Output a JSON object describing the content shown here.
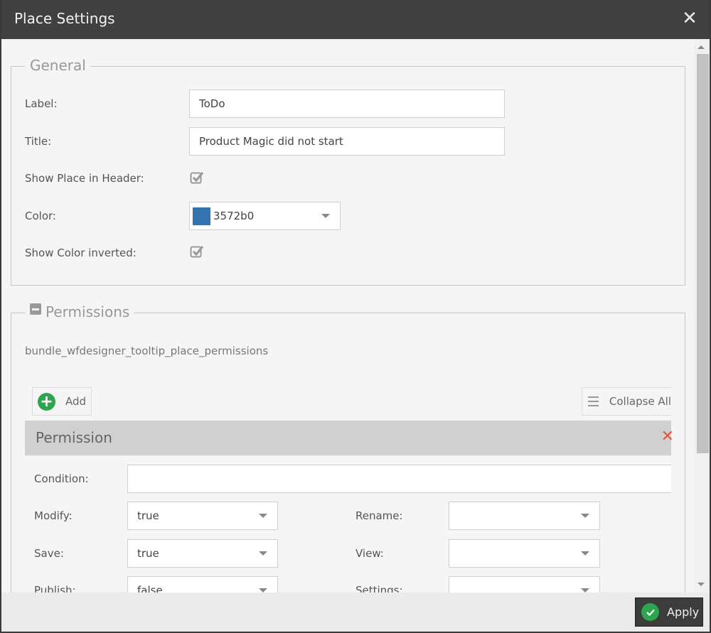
{
  "dialog": {
    "title": "Place Settings",
    "close_icon": "close-icon"
  },
  "general": {
    "legend": "General",
    "label_field": {
      "label": "Label:",
      "value": "ToDo"
    },
    "title_field": {
      "label": "Title:",
      "value": "Product Magic did not start"
    },
    "show_in_header": {
      "label": "Show Place in Header:",
      "checked": true
    },
    "color": {
      "label": "Color:",
      "value": "3572b0",
      "swatch_hex": "#3572b0"
    },
    "show_color_inverted": {
      "label": "Show Color inverted:",
      "checked": true
    }
  },
  "permissions": {
    "legend": "Permissions",
    "collapse_icon": "minus-square-icon",
    "tooltip_text": "bundle_wfdesigner_tooltip_place_permissions",
    "add_button": "Add",
    "collapse_all_button": "Collapse All",
    "items": [
      {
        "header": "Permission",
        "condition": {
          "label": "Condition:",
          "value": ""
        },
        "modify": {
          "label": "Modify:",
          "value": "true"
        },
        "save": {
          "label": "Save:",
          "value": "true"
        },
        "publish": {
          "label": "Publish:",
          "value": "false"
        },
        "rename": {
          "label": "Rename:",
          "value": ""
        },
        "view": {
          "label": "View:",
          "value": ""
        },
        "settings": {
          "label": "Settings:",
          "value": ""
        }
      }
    ]
  },
  "footer": {
    "apply_button": "Apply"
  },
  "colors": {
    "titlebar": "#404040",
    "accent_green": "#2ea44f",
    "remove_red": "#e5533c",
    "place_color": "#3572b0"
  }
}
